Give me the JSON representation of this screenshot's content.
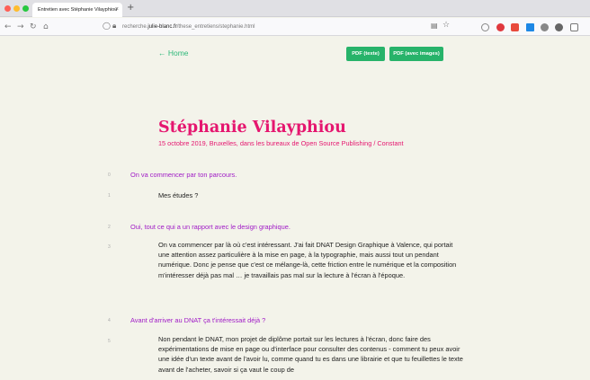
{
  "browser": {
    "tab_title": "Entretien avec Stéphanie Vilayphiou",
    "tab_close": "×",
    "new_tab": "+",
    "url_prefix": "recherche.",
    "url_domain": "julie-blanc.fr",
    "url_path": "/these_entretiens/stephanie.html",
    "icons": [
      "back-icon",
      "forward-icon",
      "reload-icon",
      "home-icon",
      "shield-icon",
      "lock-icon",
      "reader-mode-icon",
      "bookmark-star-icon"
    ]
  },
  "page": {
    "home_link": "← Home",
    "pdf_text_label": "PDF (texte)",
    "pdf_images_label": "PDF (avec images)",
    "title": "Stéphanie Vilayphiou",
    "subtitle": "15 octobre 2019, Bruxelles, dans les bureaux de Open Source Publishing / Constant",
    "entries": [
      {
        "num": "0",
        "question": "On va commencer par ton parcours."
      },
      {
        "num": "1",
        "answer": "Mes études ?"
      },
      {
        "num": "2",
        "question": "Oui, tout ce qui a un rapport avec le design graphique."
      },
      {
        "num": "3",
        "answer": "On va commencer par là où c'est intéressant. J'ai fait DNAT Design Graphique à Valence, qui portait une attention assez particulière à la mise en page, à la typographie, mais aussi tout un pendant numérique. Donc je pense que c'est ce mélange-là, cette friction entre le numérique et la composition m'intéresser déjà pas mal … je travaillais pas mal sur la lecture à l'écran à l'époque."
      },
      {
        "num": "4",
        "question": "Avant d'arriver au DNAT ça t'intéressait déjà ?"
      },
      {
        "num": "5",
        "answer": "Non pendant le DNAT, mon projet de diplôme portait sur les lectures à l'écran, donc faire des expérimentations de mise en page ou d'interface pour consulter des contenus - comment tu peux avoir une idée d'un texte avant de l'avoir lu, comme quand tu es dans une librairie et que tu feuillettes le texte avant de l'acheter, savoir si ça vaut le coup de"
      }
    ]
  },
  "colors": {
    "accent_pink": "#e5166f",
    "question_purple": "#a01bc6",
    "button_green": "#27b36a",
    "link_green": "#2fb87a",
    "page_bg": "#f3f3ea"
  }
}
